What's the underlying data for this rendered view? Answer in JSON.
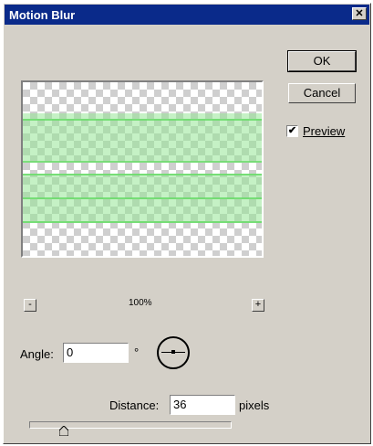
{
  "window": {
    "title": "Motion Blur",
    "close_glyph": "✕"
  },
  "buttons": {
    "ok": "OK",
    "cancel": "Cancel"
  },
  "preview": {
    "label": "Preview",
    "checked": true,
    "check_glyph": "✔"
  },
  "zoom": {
    "minus": "-",
    "plus": "+",
    "level": "100%"
  },
  "angle": {
    "label": "Angle:",
    "value": "0",
    "unit": "°",
    "dial_icon": "angle-dial-icon"
  },
  "distance": {
    "label": "Distance:",
    "value": "36",
    "unit": "pixels",
    "slider_fraction": 0.17
  },
  "colors": {
    "title_bar": "#0a2a8a",
    "dialog_bg": "#d4d0c8",
    "blur_green": "#96e696"
  }
}
